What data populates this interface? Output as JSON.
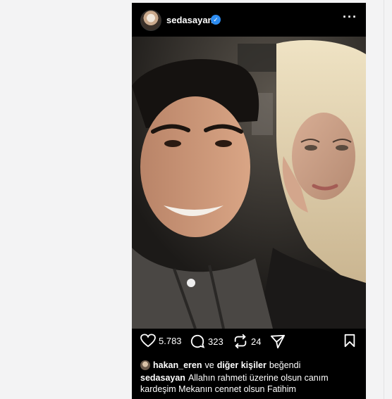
{
  "post": {
    "username": "sedasayan",
    "verified_icon": "verified-badge-icon",
    "more_icon": "more-options-icon",
    "actions": {
      "like_count": "5.783",
      "comment_count": "323",
      "repost_count": "24"
    },
    "liked_by": {
      "user": "hakan_eren",
      "connector": "ve",
      "others": "diğer kişiler",
      "suffix": "beğendi"
    },
    "caption": {
      "username": "sedasayan",
      "text": "Allahın rahmeti üzerine olsun canım kardeşim Mekanın cennet olsun Fatihim"
    }
  }
}
